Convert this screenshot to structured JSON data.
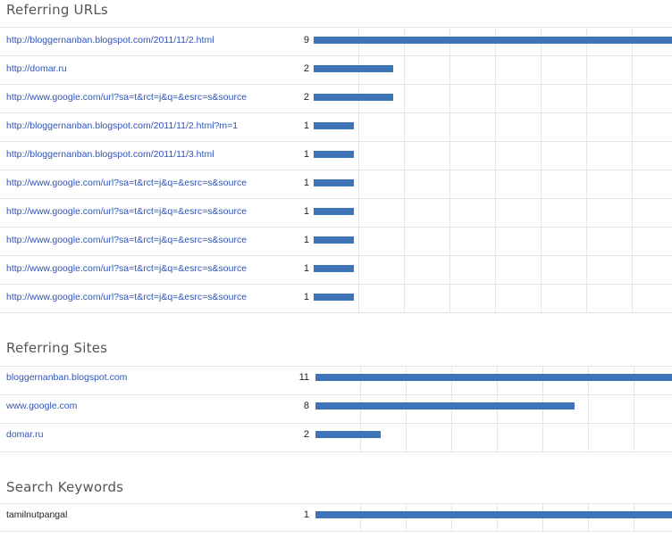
{
  "referring_urls": {
    "title": "Referring URLs",
    "max": 9,
    "rows": [
      {
        "url": "http://bloggernanban.blogspot.com/2011/11/2.html",
        "count": 9
      },
      {
        "url": "http://domar.ru",
        "count": 2
      },
      {
        "url": "http://www.google.com/url?sa=t&rct=j&q=&esrc=s&source",
        "count": 2
      },
      {
        "url": "http://bloggernanban.blogspot.com/2011/11/2.html?m=1",
        "count": 1
      },
      {
        "url": "http://bloggernanban.blogspot.com/2011/11/3.html",
        "count": 1
      },
      {
        "url": "http://www.google.com/url?sa=t&rct=j&q=&esrc=s&source",
        "count": 1
      },
      {
        "url": "http://www.google.com/url?sa=t&rct=j&q=&esrc=s&source",
        "count": 1
      },
      {
        "url": "http://www.google.com/url?sa=t&rct=j&q=&esrc=s&source",
        "count": 1
      },
      {
        "url": "http://www.google.com/url?sa=t&rct=j&q=&esrc=s&source",
        "count": 1
      },
      {
        "url": "http://www.google.com/url?sa=t&rct=j&q=&esrc=s&source",
        "count": 1
      }
    ]
  },
  "referring_sites": {
    "title": "Referring Sites",
    "max": 11,
    "rows": [
      {
        "url": "bloggernanban.blogspot.com",
        "count": 11
      },
      {
        "url": "www.google.com",
        "count": 8
      },
      {
        "url": "domar.ru",
        "count": 2
      }
    ]
  },
  "search_keywords": {
    "title": "Search Keywords",
    "max": 1,
    "rows": [
      {
        "url": "tamilnutpangal",
        "count": 1
      }
    ]
  },
  "colors": {
    "bar": "#3e75b8",
    "link": "#2f54b5",
    "grid": "#e6e6e6"
  }
}
